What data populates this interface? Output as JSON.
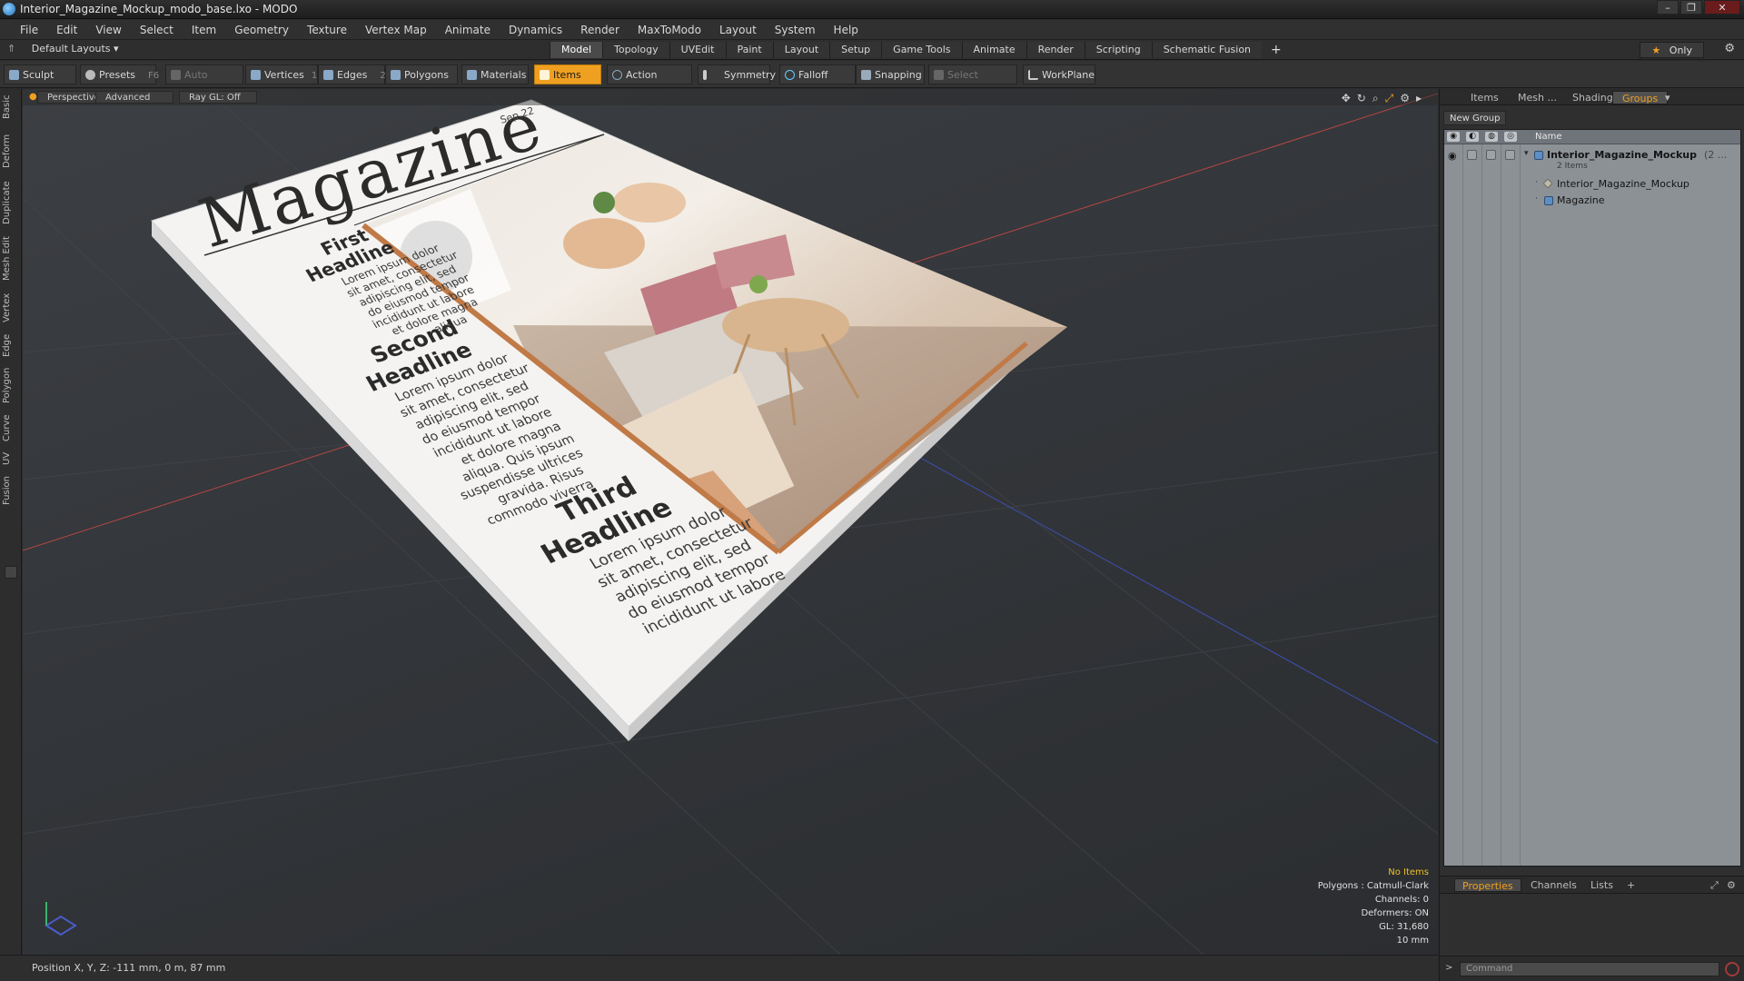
{
  "window": {
    "title": "Interior_Magazine_Mockup_modo_base.lxo - MODO",
    "buttons": [
      "–",
      "❐",
      "✕"
    ]
  },
  "menu": [
    "File",
    "Edit",
    "View",
    "Select",
    "Item",
    "Geometry",
    "Texture",
    "Vertex Map",
    "Animate",
    "Dynamics",
    "Render",
    "MaxToModo",
    "Layout",
    "System",
    "Help"
  ],
  "layout_bar": {
    "layout_selector": "Default Layouts ▾",
    "tabs": [
      "Model",
      "Topology",
      "UVEdit",
      "Paint",
      "Layout",
      "Setup",
      "Game Tools",
      "Animate",
      "Render",
      "Scripting",
      "Schematic Fusion"
    ],
    "active_tab": "Model",
    "add_tab": "+",
    "only_label": "Only"
  },
  "toolbar": {
    "sculpt": "Sculpt",
    "presets": "Presets",
    "presets_key": "F6",
    "auto_select": "Auto Select",
    "vertices": "Vertices",
    "vertices_count": "1",
    "edges": "Edges",
    "edges_count": "2",
    "polygons": "Polygons",
    "materials": "Materials",
    "items": "Items",
    "action_center": "Action Center",
    "symmetry": "Symmetry",
    "falloff": "Falloff",
    "snapping": "Snapping",
    "select_through": "Select Through",
    "workplane": "WorkPlane"
  },
  "left_tabs": [
    "Basic",
    "Deform",
    "Duplicate",
    "Mesh Edit",
    "Vertex",
    "Edge",
    "Polygon",
    "Curve",
    "UV",
    "Fusion"
  ],
  "viewport": {
    "view_mode": "Perspective",
    "advanced": "Advanced",
    "raygl": "Ray GL: Off",
    "info": {
      "selection": "No Items",
      "polygons": "Polygons : Catmull-Clark",
      "channels": "Channels: 0",
      "deformers": "Deformers: ON",
      "gl": "GL: 31,680",
      "scale": "10 mm"
    }
  },
  "magazine": {
    "masthead": "Magazine",
    "issue": "Sep.22",
    "headline1": [
      "First",
      "Headline"
    ],
    "body1": [
      "Lorem ipsum dolor",
      "sit amet, consectetur",
      "adipiscing elit, sed",
      "do eiusmod tempor",
      "incididunt ut labore",
      "et dolore magna",
      "aliqua"
    ],
    "headline2": [
      "Second",
      "Headline"
    ],
    "body2": [
      "Lorem ipsum dolor",
      "sit amet, consectetur",
      "adipiscing elit, sed",
      "do eiusmod tempor",
      "incididunt ut labore",
      "et dolore magna",
      "aliqua. Quis ipsum",
      "suspendisse ultrices",
      "gravida. Risus",
      "commodo viverra"
    ],
    "headline3": [
      "Third",
      "Headline"
    ],
    "body3": [
      "Lorem ipsum dolor",
      "sit amet, consectetur",
      "adipiscing elit, sed",
      "do eiusmod tempor",
      "incididunt ut labore"
    ]
  },
  "status": {
    "position": "Position X, Y, Z:  -111 mm, 0 m, 87 mm"
  },
  "right_panel": {
    "tabs": [
      "Items",
      "Mesh ...",
      "Shading",
      "Groups"
    ],
    "active_tab": "Groups",
    "new_group": "New Group",
    "column_name": "Name",
    "rows": [
      {
        "label": "Interior_Magazine_Mockup",
        "suffix": "(2 ...",
        "sub": "2 Items"
      },
      {
        "label": "Interior_Magazine_Mockup"
      },
      {
        "label": "Magazine"
      }
    ],
    "bottom_tabs": [
      "Properties",
      "Channels",
      "Lists",
      "+"
    ],
    "active_bottom_tab": "Properties",
    "command_placeholder": "Command"
  },
  "colors": {
    "accent": "#f0a020",
    "panel_bg": "#2f2f2f",
    "group_list_bg": "#8c9196"
  }
}
